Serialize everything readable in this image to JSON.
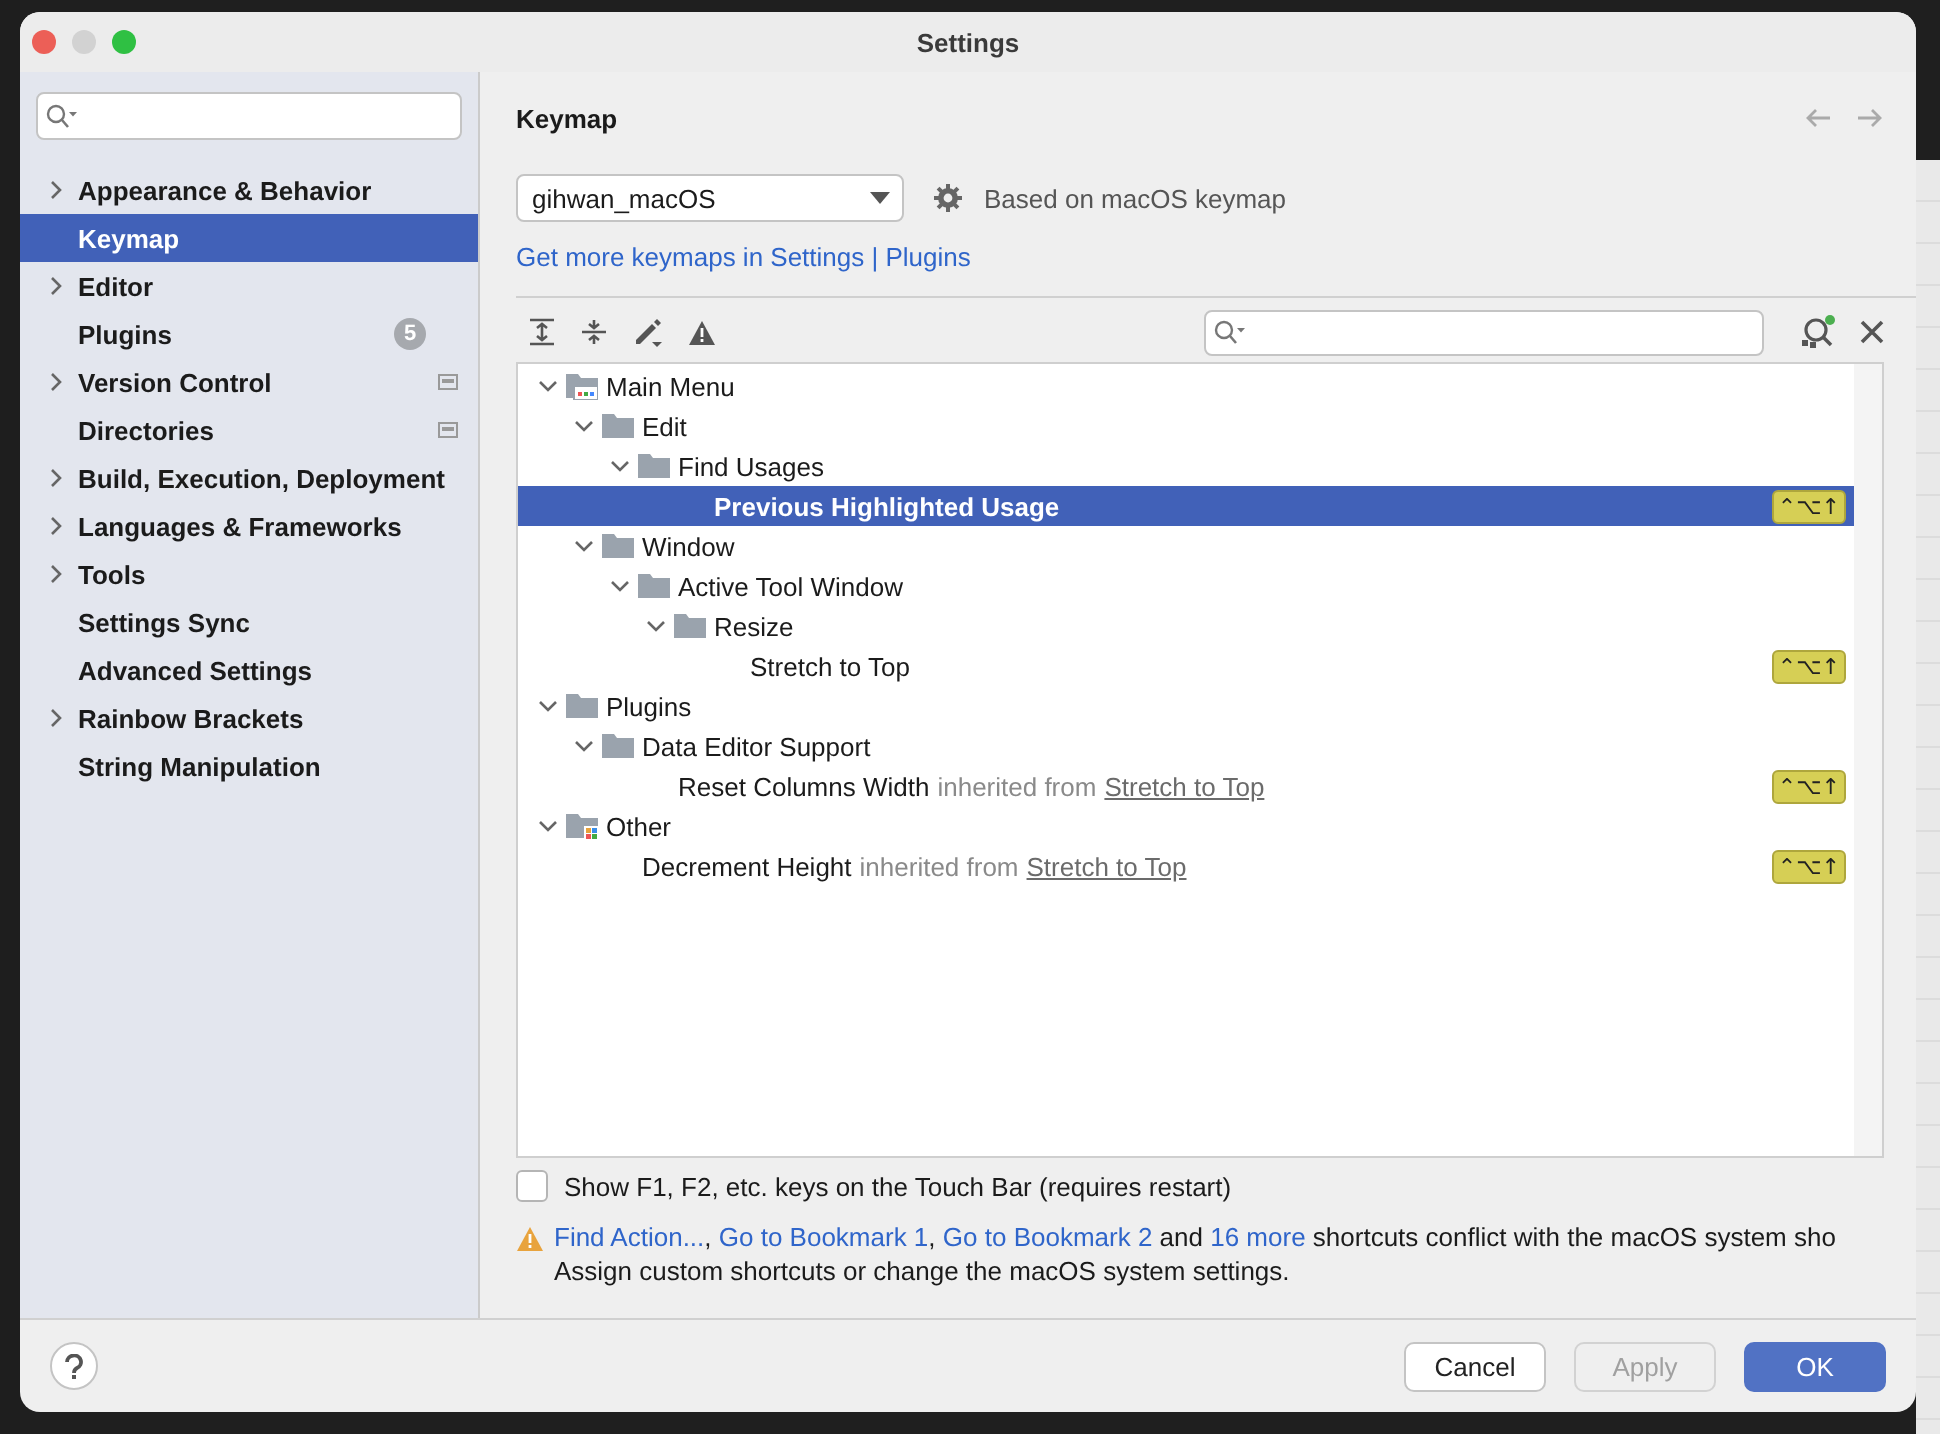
{
  "window": {
    "title": "Settings"
  },
  "sidebar": {
    "items": [
      {
        "label": "Appearance & Behavior",
        "expandable": true,
        "selected": false,
        "project_level": false
      },
      {
        "label": "Keymap",
        "expandable": false,
        "selected": true,
        "project_level": false
      },
      {
        "label": "Editor",
        "expandable": true,
        "selected": false,
        "project_level": false
      },
      {
        "label": "Plugins",
        "expandable": false,
        "selected": false,
        "project_level": false,
        "badge": "5"
      },
      {
        "label": "Version Control",
        "expandable": true,
        "selected": false,
        "project_level": true
      },
      {
        "label": "Directories",
        "expandable": false,
        "selected": false,
        "project_level": true
      },
      {
        "label": "Build, Execution, Deployment",
        "expandable": true,
        "selected": false,
        "project_level": false
      },
      {
        "label": "Languages & Frameworks",
        "expandable": true,
        "selected": false,
        "project_level": false
      },
      {
        "label": "Tools",
        "expandable": true,
        "selected": false,
        "project_level": false
      },
      {
        "label": "Settings Sync",
        "expandable": false,
        "selected": false,
        "project_level": false
      },
      {
        "label": "Advanced Settings",
        "expandable": false,
        "selected": false,
        "project_level": false
      },
      {
        "label": "Rainbow Brackets",
        "expandable": true,
        "selected": false,
        "project_level": false
      },
      {
        "label": "String Manipulation",
        "expandable": false,
        "selected": false,
        "project_level": false
      }
    ]
  },
  "keymap": {
    "title": "Keymap",
    "scheme": "gihwan_macOS",
    "based_on": "Based on macOS keymap",
    "more_link": "Get more keymaps in Settings | Plugins"
  },
  "tree": [
    {
      "label": "Main Menu",
      "kind": "menu",
      "expanded": true,
      "selected": false,
      "children": [
        {
          "label": "Edit",
          "kind": "folder",
          "expanded": true,
          "selected": false,
          "children": [
            {
              "label": "Find Usages",
              "kind": "folder",
              "expanded": true,
              "selected": false,
              "children": [
                {
                  "label": "Previous Highlighted Usage",
                  "kind": "action",
                  "selected": true,
                  "shortcut": "⌃⌥↑"
                }
              ]
            }
          ]
        },
        {
          "label": "Window",
          "kind": "folder",
          "expanded": true,
          "selected": false,
          "children": [
            {
              "label": "Active Tool Window",
              "kind": "folder",
              "expanded": true,
              "selected": false,
              "children": [
                {
                  "label": "Resize",
                  "kind": "folder",
                  "expanded": true,
                  "selected": false,
                  "children": [
                    {
                      "label": "Stretch to Top",
                      "kind": "action",
                      "selected": false,
                      "shortcut": "⌃⌥↑"
                    }
                  ]
                }
              ]
            }
          ]
        }
      ]
    },
    {
      "label": "Plugins",
      "kind": "folder",
      "expanded": true,
      "selected": false,
      "children": [
        {
          "label": "Data Editor Support",
          "kind": "folder",
          "expanded": true,
          "selected": false,
          "children": [
            {
              "label": "Reset Columns Width",
              "kind": "action",
              "selected": false,
              "note": "inherited from",
              "source": "Stretch to Top",
              "shortcut": "⌃⌥↑"
            }
          ]
        }
      ]
    },
    {
      "label": "Other",
      "kind": "other",
      "expanded": true,
      "selected": false,
      "children": [
        {
          "label": "Decrement Height",
          "kind": "action",
          "selected": false,
          "note": "inherited from",
          "source": "Stretch to Top",
          "shortcut": "⌃⌥↑"
        }
      ]
    }
  ],
  "touch_bar": {
    "label": "Show F1, F2, etc. keys on the Touch Bar (requires restart)",
    "checked": false
  },
  "conflict": {
    "links": [
      {
        "text": "Find Action...",
        "after": ", "
      },
      {
        "text": "Go to Bookmark 1",
        "after": ", "
      },
      {
        "text": "Go to Bookmark 2",
        "after": " and "
      },
      {
        "text": "16 more",
        "after": " shortcuts conflict with the macOS system sho"
      }
    ],
    "line2": "Assign custom shortcuts or change the macOS system settings."
  },
  "buttons": [
    {
      "label": "Cancel",
      "kind": "default",
      "disabled": false
    },
    {
      "label": "Apply",
      "kind": "default",
      "disabled": true
    },
    {
      "label": "OK",
      "kind": "primary",
      "disabled": false
    }
  ]
}
